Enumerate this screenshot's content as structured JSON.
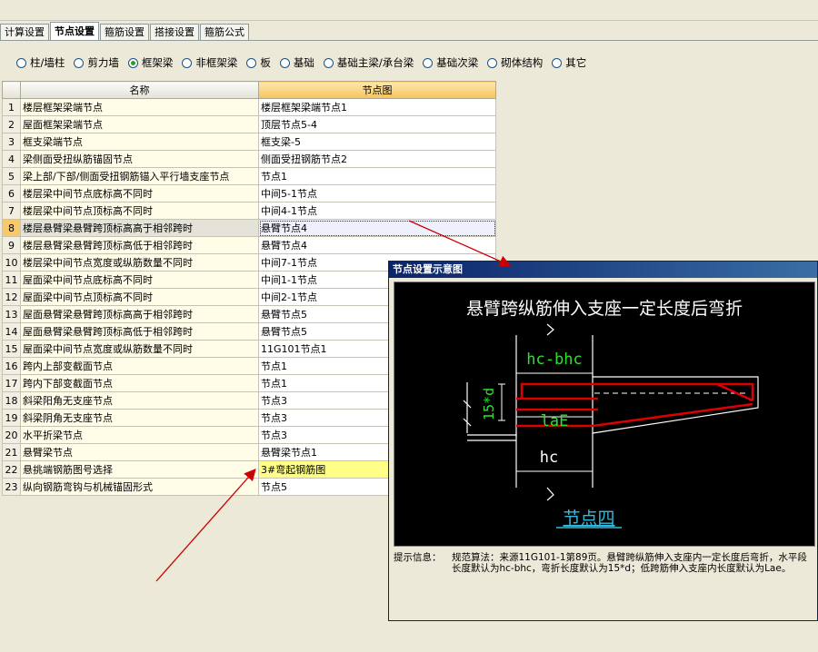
{
  "tabs": [
    "计算设置",
    "节点设置",
    "箍筋设置",
    "搭接设置",
    "箍筋公式"
  ],
  "active_tab": 1,
  "radios": [
    {
      "label": "柱/墙柱",
      "checked": false
    },
    {
      "label": "剪力墙",
      "checked": false
    },
    {
      "label": "框架梁",
      "checked": true
    },
    {
      "label": "非框架梁",
      "checked": false
    },
    {
      "label": "板",
      "checked": false
    },
    {
      "label": "基础",
      "checked": false
    },
    {
      "label": "基础主梁/承台梁",
      "checked": false
    },
    {
      "label": "基础次梁",
      "checked": false
    },
    {
      "label": "砌体结构",
      "checked": false
    },
    {
      "label": "其它",
      "checked": false
    }
  ],
  "table": {
    "headers": [
      "名称",
      "节点图"
    ],
    "selected_row": 8,
    "highlight_row": 22,
    "rows": [
      {
        "no": "1",
        "name": "楼层框架梁端节点",
        "value": "楼层框架梁端节点1"
      },
      {
        "no": "2",
        "name": "屋面框架梁端节点",
        "value": "顶层节点5-4"
      },
      {
        "no": "3",
        "name": "框支梁端节点",
        "value": "框支梁-5"
      },
      {
        "no": "4",
        "name": "梁侧面受扭纵筋锚固节点",
        "value": "侧面受扭钢筋节点2"
      },
      {
        "no": "5",
        "name": "梁上部/下部/侧面受扭钢筋锚入平行墙支座节点",
        "value": "节点1"
      },
      {
        "no": "6",
        "name": "楼层梁中间节点底标高不同时",
        "value": "中间5-1节点"
      },
      {
        "no": "7",
        "name": "楼层梁中间节点顶标高不同时",
        "value": "中间4-1节点"
      },
      {
        "no": "8",
        "name": "楼层悬臂梁悬臂跨顶标高高于相邻跨时",
        "value": "悬臂节点4"
      },
      {
        "no": "9",
        "name": "楼层悬臂梁悬臂跨顶标高低于相邻跨时",
        "value": "悬臂节点4"
      },
      {
        "no": "10",
        "name": "楼层梁中间节点宽度或纵筋数量不同时",
        "value": "中间7-1节点"
      },
      {
        "no": "11",
        "name": "屋面梁中间节点底标高不同时",
        "value": "中间1-1节点"
      },
      {
        "no": "12",
        "name": "屋面梁中间节点顶标高不同时",
        "value": "中间2-1节点"
      },
      {
        "no": "13",
        "name": "屋面悬臂梁悬臂跨顶标高高于相邻跨时",
        "value": "悬臂节点5"
      },
      {
        "no": "14",
        "name": "屋面悬臂梁悬臂跨顶标高低于相邻跨时",
        "value": "悬臂节点5"
      },
      {
        "no": "15",
        "name": "屋面梁中间节点宽度或纵筋数量不同时",
        "value": "11G101节点1"
      },
      {
        "no": "16",
        "name": "跨内上部变截面节点",
        "value": "节点1"
      },
      {
        "no": "17",
        "name": "跨内下部变截面节点",
        "value": "节点1"
      },
      {
        "no": "18",
        "name": "斜梁阳角无支座节点",
        "value": "节点3"
      },
      {
        "no": "19",
        "name": "斜梁阴角无支座节点",
        "value": "节点3"
      },
      {
        "no": "20",
        "name": "水平折梁节点",
        "value": "节点3"
      },
      {
        "no": "21",
        "name": "悬臂梁节点",
        "value": "悬臂梁节点1"
      },
      {
        "no": "22",
        "name": "悬挑端钢筋图号选择",
        "value": "3#弯起钢筋图"
      },
      {
        "no": "23",
        "name": "纵向钢筋弯钩与机械锚固形式",
        "value": "节点5"
      }
    ]
  },
  "dialog": {
    "title": "节点设置示意图",
    "drawing_title": "悬臂跨纵筋伸入支座一定长度后弯折",
    "dim_hc_bhc": "hc-bhc",
    "dim_15d": "15*d",
    "dim_lae": "laE",
    "dim_hc": "hc",
    "node_label": "节点四",
    "info_label": "提示信息：",
    "info_text": "规范算法：来源11G101-1第89页。悬臂跨纵筋伸入支座内一定长度后弯折，水平段长度默认为hc-bhc，弯折长度默认为15*d；低跨筋伸入支座内长度默认为Lae。"
  },
  "colors": {
    "annotation_arrow": "#cc0000",
    "rebar": "#dd0000",
    "dimension": "#33dd33",
    "node_label": "#33bbdd"
  }
}
